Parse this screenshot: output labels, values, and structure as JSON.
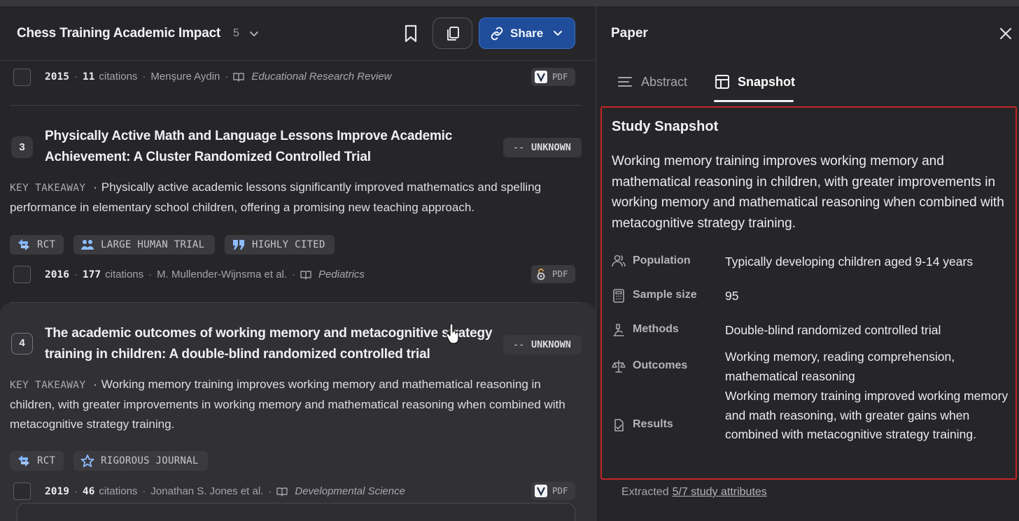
{
  "header": {
    "title": "Chess Training Academic Impact",
    "count": "5",
    "share_label": "Share"
  },
  "papers": [
    {
      "year": "2015",
      "citations": "11",
      "citations_label": "citations",
      "author": "Menşure Aydin",
      "journal": "Educational Research Review",
      "pdf_label": "PDF"
    },
    {
      "number": "3",
      "title": "Physically Active Math and Language Lessons Improve Academic Achievement: A Cluster Randomized Controlled Trial",
      "status": "UNKNOWN",
      "takeaway_label": "KEY TAKEAWAY",
      "takeaway": "Physically active academic lessons significantly improved mathematics and spelling performance in elementary school children, offering a promising new teaching approach.",
      "tags": [
        "RCT",
        "LARGE HUMAN TRIAL",
        "HIGHLY CITED"
      ],
      "year": "2016",
      "citations": "177",
      "citations_label": "citations",
      "author": "M. Mullender-Wijnsma et al.",
      "journal": "Pediatrics",
      "pdf_label": "PDF"
    },
    {
      "number": "4",
      "title": "The academic outcomes of working memory and metacognitive strategy training in children: A double-blind randomized controlled trial",
      "status": "UNKNOWN",
      "takeaway_label": "KEY TAKEAWAY",
      "takeaway": "Working memory training improves working memory and mathematical reasoning in children, with greater improvements in working memory and mathematical reasoning when combined with metacognitive strategy training.",
      "tags": [
        "RCT",
        "RIGOROUS JOURNAL"
      ],
      "year": "2019",
      "citations": "46",
      "citations_label": "citations",
      "author": "Jonathan S. Jones et al.",
      "journal": "Developmental Science",
      "pdf_label": "PDF"
    }
  ],
  "panel": {
    "title": "Paper",
    "tabs": [
      "Abstract",
      "Snapshot"
    ],
    "active_tab": "Snapshot",
    "snapshot_heading": "Study Snapshot",
    "summary": "Working memory training improves working memory and mathematical reasoning in children, with greater improvements in working memory and mathematical reasoning when combined with metacognitive strategy training.",
    "attributes": [
      {
        "key": "Population",
        "value": "Typically developing children aged 9-14 years",
        "icon": "people-icon"
      },
      {
        "key": "Sample size",
        "value": "95",
        "icon": "calculator-icon"
      },
      {
        "key": "Methods",
        "value": "Double-blind randomized controlled trial",
        "icon": "microscope-icon"
      },
      {
        "key": "Outcomes",
        "value": "Working memory, reading comprehension, mathematical reasoning",
        "icon": "scales-icon"
      },
      {
        "key": "Results",
        "value": "Working memory training improved working memory and math reasoning, with greater gains when combined with metacognitive strategy training.",
        "icon": "results-icon"
      }
    ],
    "extracted_prefix": "Extracted",
    "extracted_link": "5/7 study attributes"
  },
  "colors": {
    "share_button": "#1f4d99",
    "snapshot_border": "#c42525",
    "background": "#262629"
  }
}
